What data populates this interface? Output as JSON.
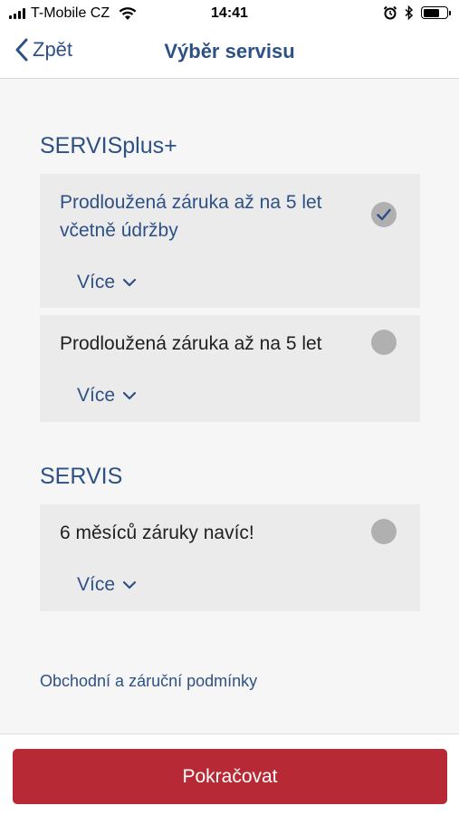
{
  "status_bar": {
    "carrier": "T-Mobile CZ",
    "time": "14:41",
    "icons": [
      "signal-icon",
      "wifi-icon",
      "alarm-icon",
      "bluetooth-icon",
      "battery-icon"
    ],
    "battery_level": 0.7
  },
  "nav": {
    "back_label": "Zpět",
    "title": "Výběr servisu"
  },
  "sections": [
    {
      "title": "SERVISplus+",
      "options": [
        {
          "label": "Prodloužená záruka až na 5 let včetně údržby",
          "selected": true,
          "more_label": "Více"
        },
        {
          "label": "Prodloužená záruka až na 5 let",
          "selected": false,
          "more_label": "Více"
        }
      ]
    },
    {
      "title": "SERVIS",
      "options": [
        {
          "label": "6 měsíců záruky navíc!",
          "selected": false,
          "more_label": "Více"
        }
      ]
    }
  ],
  "terms_link": "Obchodní a záruční podmínky",
  "footer": {
    "continue_label": "Pokračovat"
  },
  "colors": {
    "accent": "#2e5185",
    "primary_button": "#b72a35",
    "card_background": "#ebebeb",
    "radio_unselected": "#b0b0b0"
  }
}
